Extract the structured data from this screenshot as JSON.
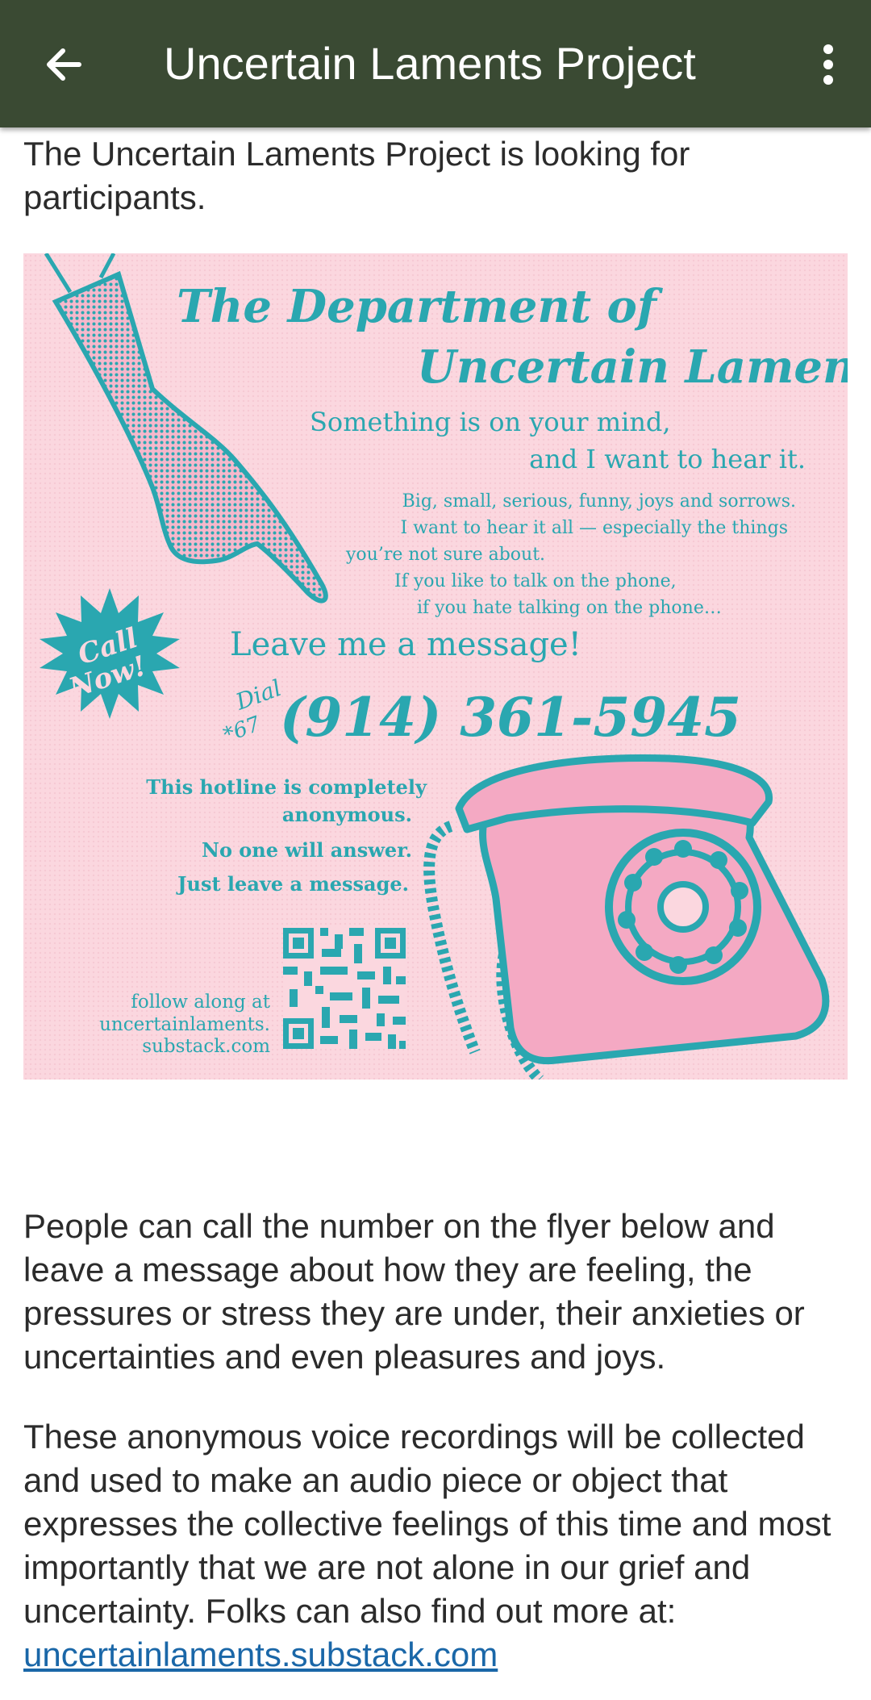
{
  "appbar": {
    "title": "Uncertain Laments Project",
    "back_icon": "arrow-left-icon",
    "menu_icon": "more-vert-icon",
    "background": "#3a4a33"
  },
  "content": {
    "intro": "The Uncertain Laments Project is looking for participants.",
    "para1": "People can call the number on the flyer below and leave a message about how they are feeling, the pressures or stress they are under, their anxieties or uncertainties and even pleasures and joys.",
    "para2_text": "These anonymous voice recordings will be collected and used to make an audio piece or object that expresses the collective feelings of this time and most importantly that we are not alone in our grief and uncertainty. Folks can also find out more at:  ",
    "para2_link": "uncertainlaments.substack.com"
  },
  "flyer": {
    "title1": "The Department of",
    "title2": "Uncertain Laments",
    "sub1": "Something is on your mind,",
    "sub2": "and I want to hear it.",
    "body1": "Big, small, serious, funny, joys and sorrows.",
    "body2": "I want to hear it all — especially the things",
    "body3": "you’re not sure about.",
    "body4": "If you like to talk on the phone,",
    "body5": "if you hate talking on the phone…",
    "badge1": "Call",
    "badge2": "Now!",
    "leave": "Leave me a message!",
    "dial": "Dial",
    "prefix": "*67",
    "phone": "(914) 361-5945",
    "note1": "This hotline is completely",
    "note2": "anonymous.",
    "note3": "No one will answer.",
    "note4": "Just leave a message.",
    "follow1": "follow along at",
    "follow2": "uncertainlaments.",
    "follow3": "substack.com",
    "colors": {
      "bg": "#fbd7df",
      "teal": "#2aa7b0",
      "pink": "#f4a9c3"
    }
  }
}
